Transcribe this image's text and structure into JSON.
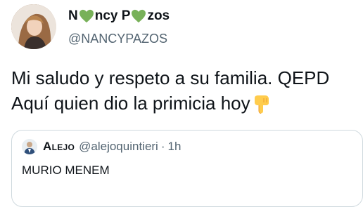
{
  "author": {
    "name_parts": [
      "N",
      "ncy P",
      "zos"
    ],
    "name_glyphs": [
      "green-heart-icon",
      "green-heart-icon"
    ],
    "handle": "@NANCYPAZOS"
  },
  "tweet": {
    "line1": "Mi saludo y respeto a su familia. QEPD",
    "line2": "Aquí quien dio la primicia hoy",
    "emoji": "backhand-index-pointing-down-icon"
  },
  "quoted": {
    "name": "Alejo",
    "handle": "@alejoquintieri",
    "separator": "·",
    "time": "1h",
    "text": "MURIO MENEM"
  },
  "colors": {
    "text": "#0f1419",
    "secondary": "#536471",
    "border": "#cfd9de",
    "heart": "#78b159",
    "finger": "#ffcc4d"
  }
}
